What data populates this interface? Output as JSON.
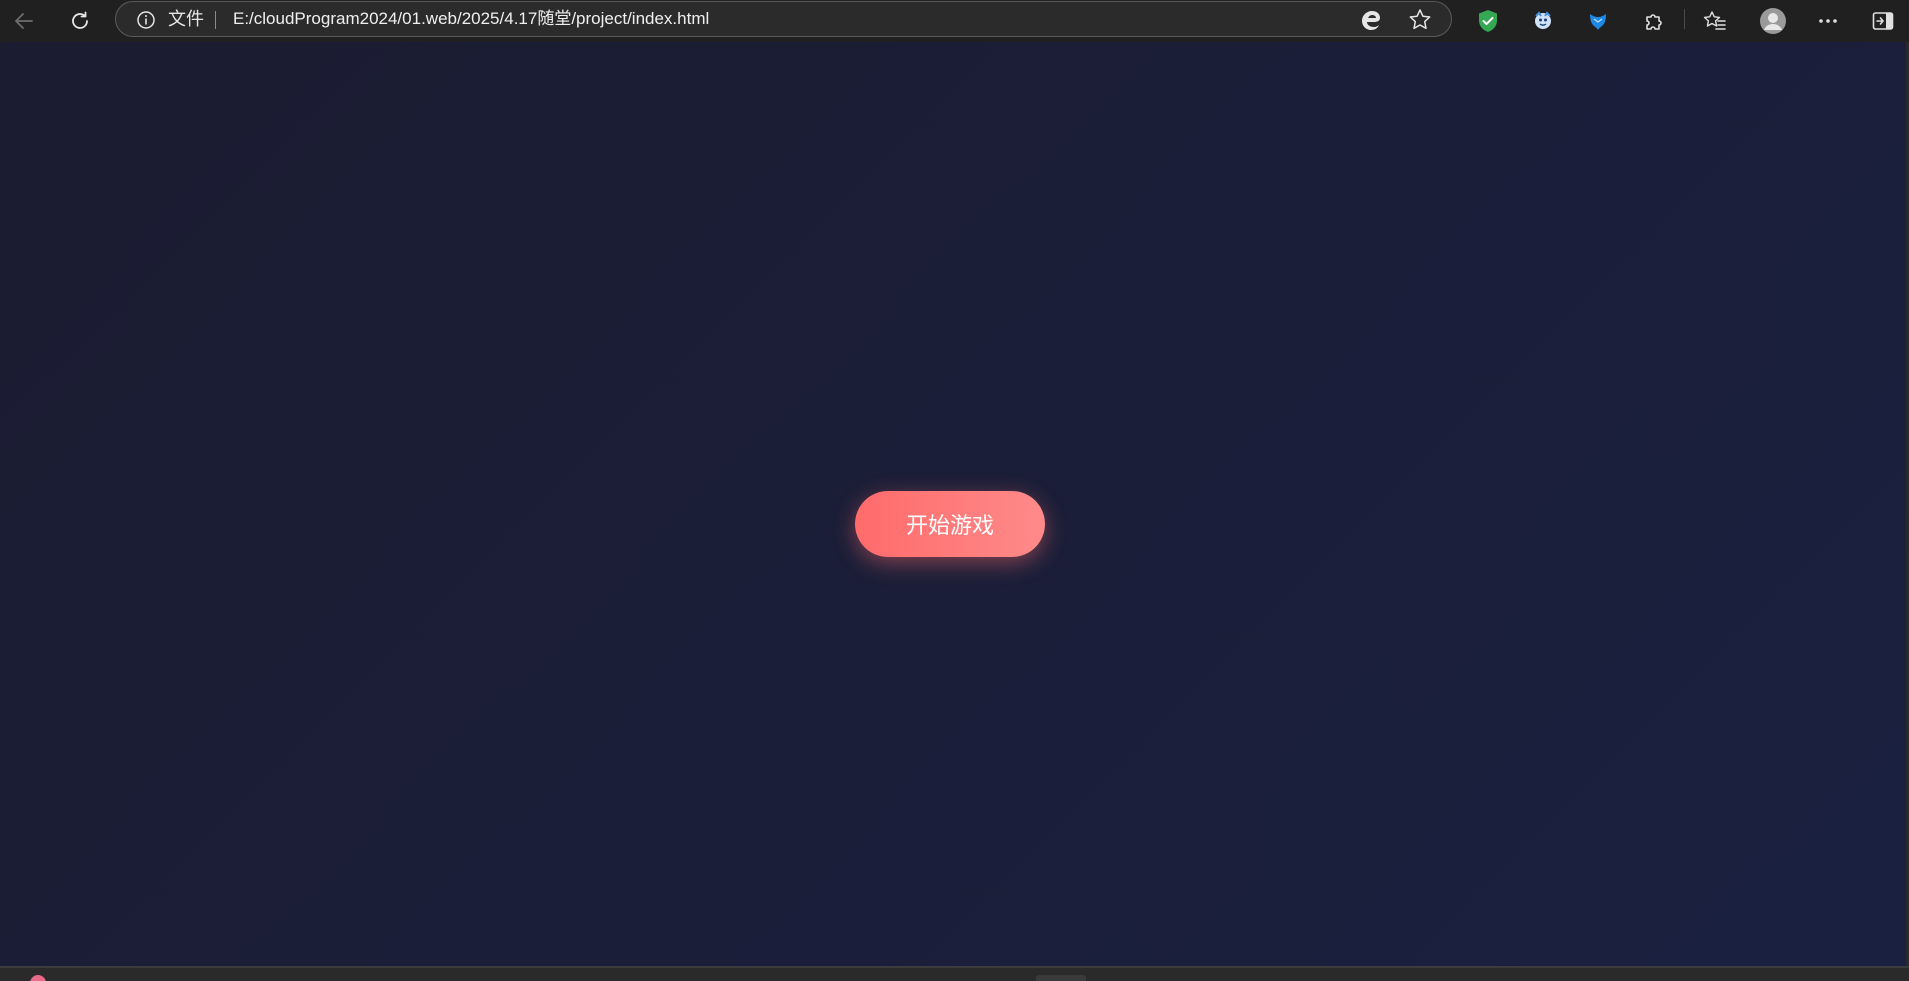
{
  "toolbar": {
    "back_icon": "arrow-left-icon",
    "reload_icon": "reload-icon",
    "address_bar": {
      "info_icon": "info-icon",
      "site_label": "文件",
      "url": "E:/cloudProgram2024/01.web/2025/4.17随堂/project/index.html",
      "edge_icon": "edge-icon",
      "favorite_add_icon": "star-icon"
    },
    "extensions": [
      {
        "icon": "shield-check-icon",
        "color": "#34a853"
      },
      {
        "icon": "face-icon",
        "color": "#4a90d9"
      },
      {
        "icon": "bird-icon",
        "color": "#1e88e5"
      },
      {
        "icon": "puzzle-icon",
        "color": "#d0d0d0"
      }
    ],
    "favorites_icon": "favorites-list-icon",
    "profile_icon": "avatar-icon",
    "more_icon": "ellipsis-icon",
    "sidebar_icon": "sidebar-icon"
  },
  "page": {
    "start_button_label": "开始游戏",
    "button_color": "#ff6b6b",
    "background_colors": [
      "#1b1c31",
      "#1a2040"
    ]
  }
}
